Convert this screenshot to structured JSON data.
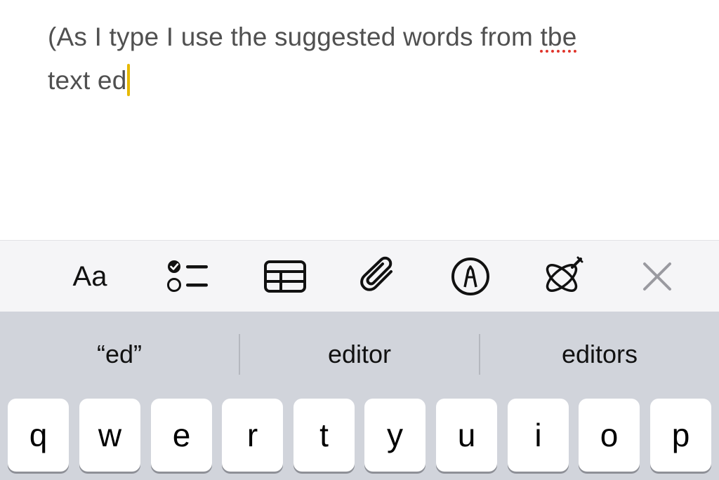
{
  "note": {
    "line1_text": "(As I type I use the suggested words from ",
    "misspelled_word": "tbe",
    "line2_text": "text ed"
  },
  "toolbar": {
    "format_label": "Aa",
    "items": [
      {
        "name": "format-text",
        "icon": "Aa"
      },
      {
        "name": "checklist",
        "icon": "checklist-icon"
      },
      {
        "name": "table",
        "icon": "table-icon"
      },
      {
        "name": "attachment",
        "icon": "paperclip-icon"
      },
      {
        "name": "markup",
        "icon": "pen-circle-icon"
      },
      {
        "name": "writing-tools",
        "icon": "writing-tools-icon"
      },
      {
        "name": "close",
        "icon": "close-icon"
      }
    ]
  },
  "predictions": [
    "“ed”",
    "editor",
    "editors"
  ],
  "keyboard": {
    "row1": [
      "q",
      "w",
      "e",
      "r",
      "t",
      "y",
      "u",
      "i",
      "o",
      "p"
    ]
  },
  "colors": {
    "text": "#505050",
    "caret": "#e6b800",
    "misspell_underline": "#e0352b",
    "toolbar_bg": "#f5f5f7",
    "keyboard_bg": "#d1d4db",
    "close_icon": "#9a9aa0"
  }
}
